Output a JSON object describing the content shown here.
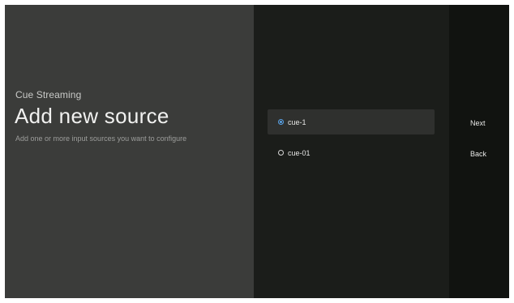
{
  "left": {
    "app_name": "Cue Streaming",
    "title": "Add new source",
    "description": "Add one or more input sources you want to configure"
  },
  "sources": [
    {
      "label": "cue-1",
      "selected": true
    },
    {
      "label": "cue-01",
      "selected": false
    }
  ],
  "actions": {
    "next_label": "Next",
    "back_label": "Back"
  },
  "colors": {
    "accent": "#5aa3e8",
    "left_panel": "#3b3c3a",
    "middle_panel": "#1b1d1a",
    "right_panel": "#111310",
    "selected_row": "#2f302e"
  }
}
